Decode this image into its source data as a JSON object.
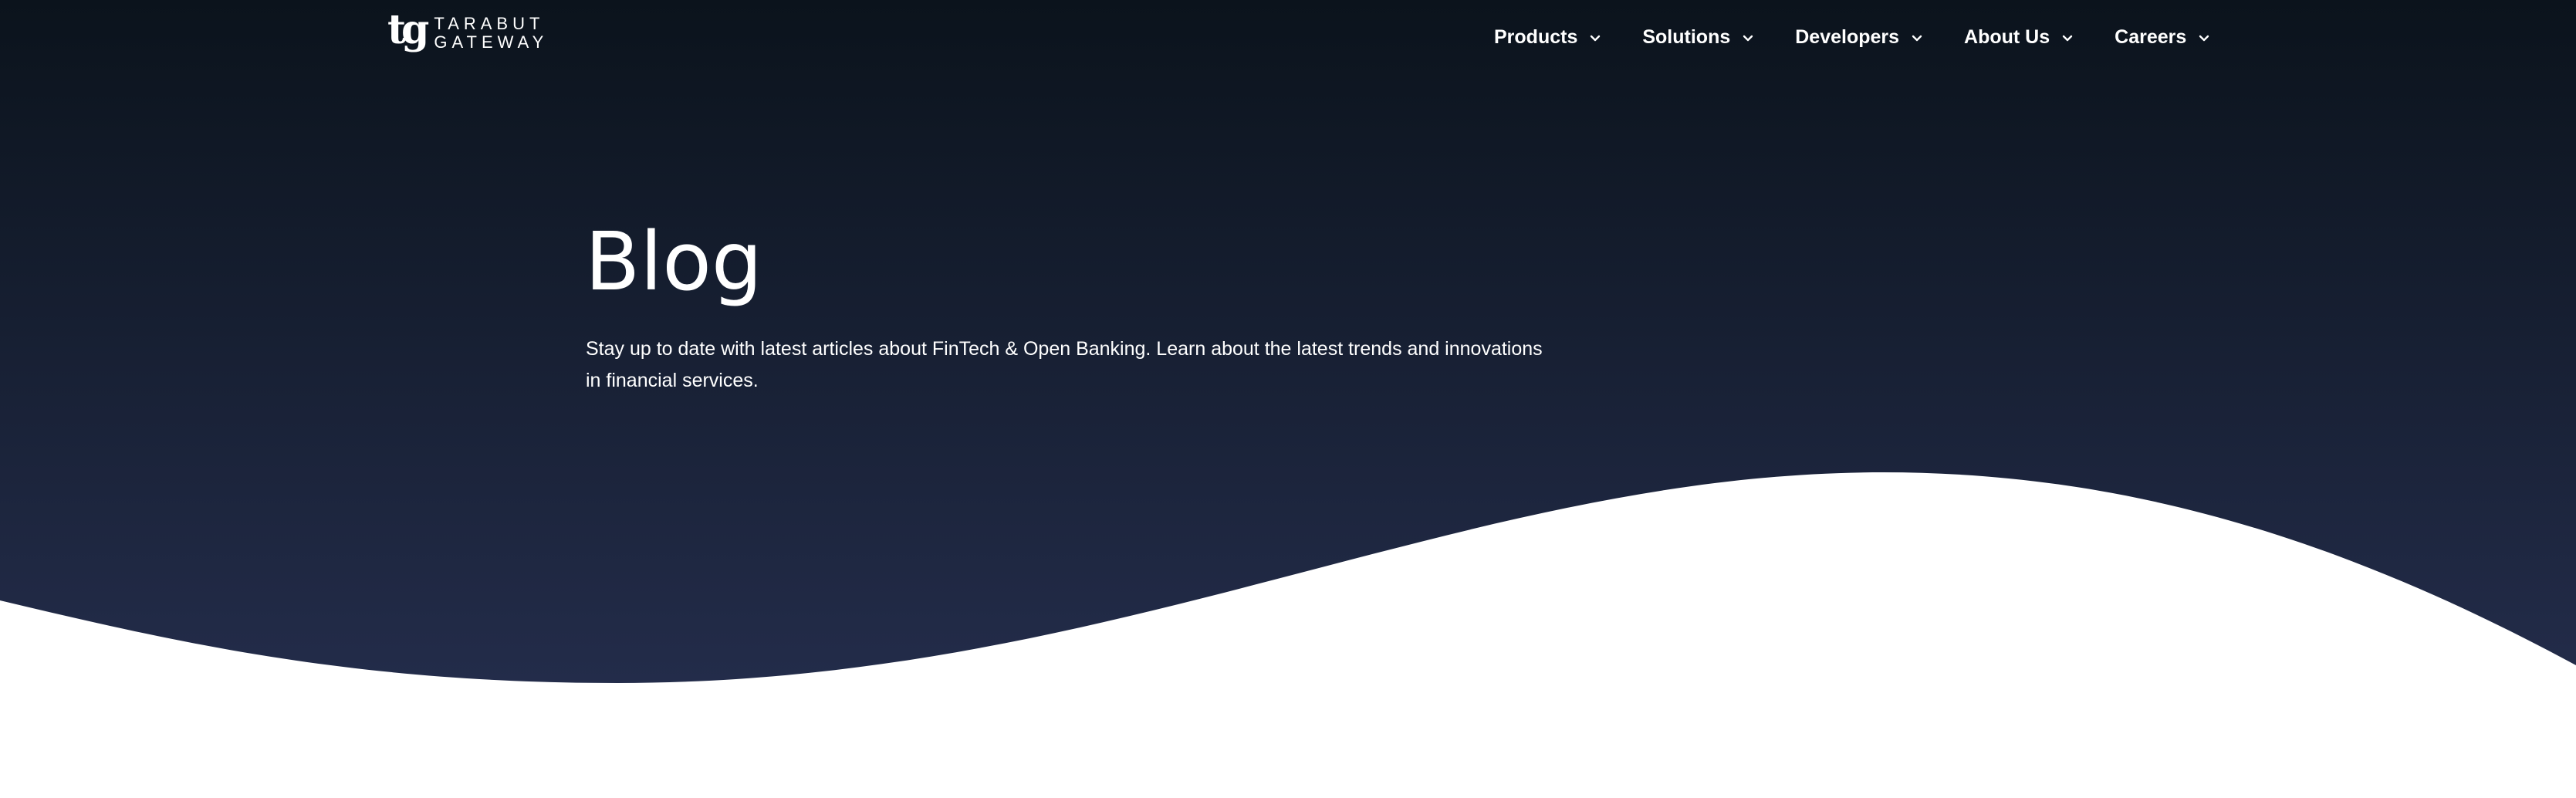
{
  "colors": {
    "hero_top": "#0b131c",
    "hero_bottom": "#232c4a",
    "page_background": "#ffffff",
    "text": "#ffffff"
  },
  "header": {
    "logo": {
      "mark": "tg",
      "line1": "TARABUT",
      "line2": "GATEWAY"
    },
    "nav": [
      {
        "label": "Products",
        "icon": "chevron-down-icon"
      },
      {
        "label": "Solutions",
        "icon": "chevron-down-icon"
      },
      {
        "label": "Developers",
        "icon": "chevron-down-icon"
      },
      {
        "label": "About Us",
        "icon": "chevron-down-icon"
      },
      {
        "label": "Careers",
        "icon": "chevron-down-icon"
      }
    ]
  },
  "hero": {
    "title": "Blog",
    "subtitle": "Stay up to date with latest articles about FinTech & Open Banking. Learn about the latest trends and innovations in financial services."
  }
}
